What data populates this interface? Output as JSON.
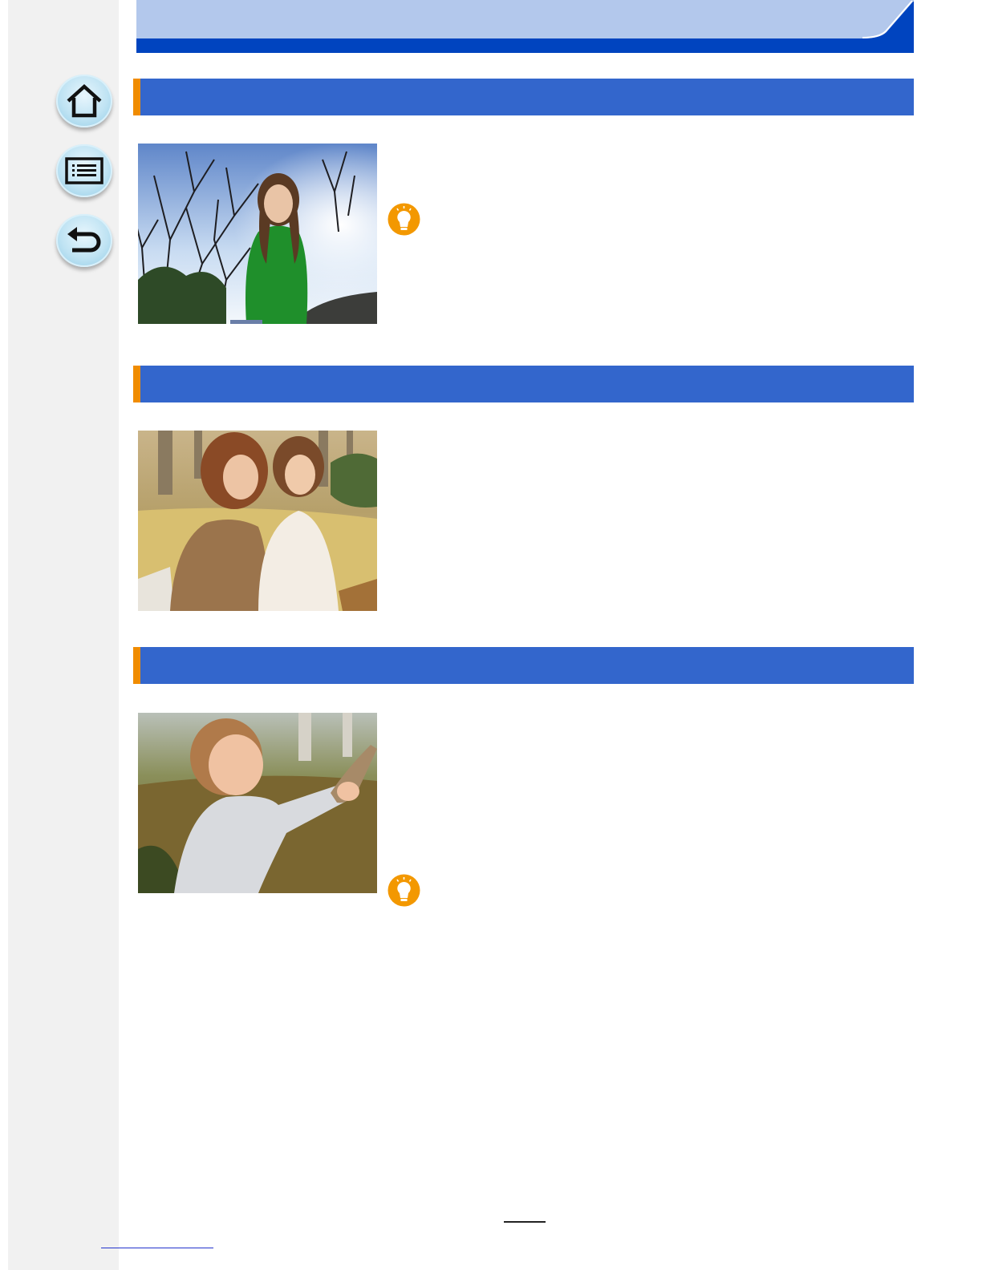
{
  "colors": {
    "header_light": "#b3c8ec",
    "header_dark": "#0044bf",
    "section_bar": "#3366cc",
    "section_accent": "#f08c00",
    "tip_icon": "#f39800",
    "rail": "#f1f1f1"
  },
  "header": {
    "title": ""
  },
  "nav": {
    "items": [
      {
        "icon": "home-icon"
      },
      {
        "icon": "contents-list-icon"
      },
      {
        "icon": "back-arrow-icon"
      }
    ]
  },
  "sections": [
    {
      "title": "",
      "photo": "girl-green-sweater-trees-photo",
      "has_tip": true
    },
    {
      "title": "",
      "photo": "mother-daughter-autumn-park-photo",
      "has_tip": false
    },
    {
      "title": "",
      "photo": "toddler-grey-hoodie-park-photo",
      "has_tip": true
    }
  ],
  "footer": {
    "page_number": "",
    "link_text": ""
  }
}
